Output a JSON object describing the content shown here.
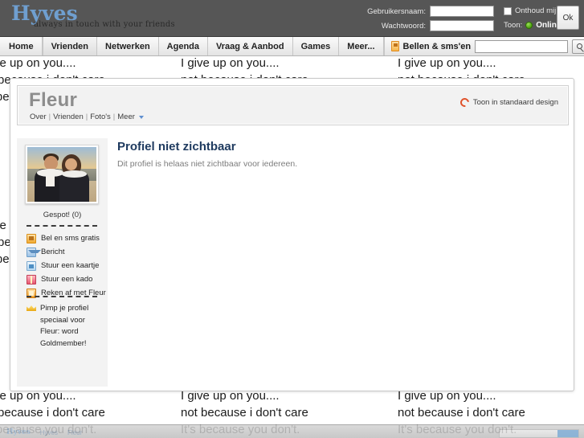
{
  "header": {
    "logo_main": "Hyves",
    "logo_tagline": "always in touch with your friends",
    "username_label": "Gebruikersnaam:",
    "password_label": "Wachtwoord:",
    "username_value": "",
    "password_value": "",
    "remember_label": "Onthoud mij",
    "toon_label": "Toon:",
    "status_value": "Online",
    "ok_label": "Ok"
  },
  "nav": {
    "items": [
      {
        "label": "Home",
        "active": false
      },
      {
        "label": "Vrienden",
        "active": true
      },
      {
        "label": "Netwerken",
        "active": false
      },
      {
        "label": "Agenda",
        "active": false
      },
      {
        "label": "Vraag & Aanbod",
        "active": false
      },
      {
        "label": "Games",
        "active": false
      },
      {
        "label": "Meer...",
        "active": false
      }
    ],
    "call_sms_label": "Bellen & sms'en",
    "search_value": "",
    "search_placeholder": ""
  },
  "profile": {
    "name": "Fleur",
    "sublinks": [
      "Over",
      "Vrienden",
      "Foto's",
      "Meer"
    ],
    "standard_design_label": "Toon in standaard design",
    "gespot_label": "Gespot! (0)",
    "actions": [
      {
        "label": "Bel en sms gratis",
        "icon": "phone-icon"
      },
      {
        "label": "Bericht",
        "icon": "mail-icon"
      },
      {
        "label": "Stuur een kaartje",
        "icon": "card-icon"
      },
      {
        "label": "Stuur een kado",
        "icon": "gift-icon"
      },
      {
        "label": "Reken af met Fleur",
        "icon": "pay-icon"
      }
    ],
    "pimp_text": "Pimp je profiel speciaal voor Fleur: word Goldmember!",
    "pimp_icon": "crown-icon",
    "not_visible_title": "Profiel niet zichtbaar",
    "not_visible_body": "Dit profiel is helaas niet zichtbaar voor iedereen."
  },
  "background_lyrics": {
    "line1": "I give up on you....",
    "line2": "not because i don't care",
    "line3": "It's because you don't.",
    "line1_clip_a": "up on you....",
    "line2_clip_a": "ecause i don't care",
    "line3_clip_a": "ca"
  },
  "taskbar": {
    "logo": "Hyves",
    "crumb1": "Hyves",
    "crumb2": "Fleur"
  },
  "colors": {
    "topbar_bg": "#565656",
    "logo_blue": "#6f9fd0",
    "title_navy": "#1e3a5f",
    "accent_orange": "#e0522a",
    "online_green": "#4ba30e"
  }
}
